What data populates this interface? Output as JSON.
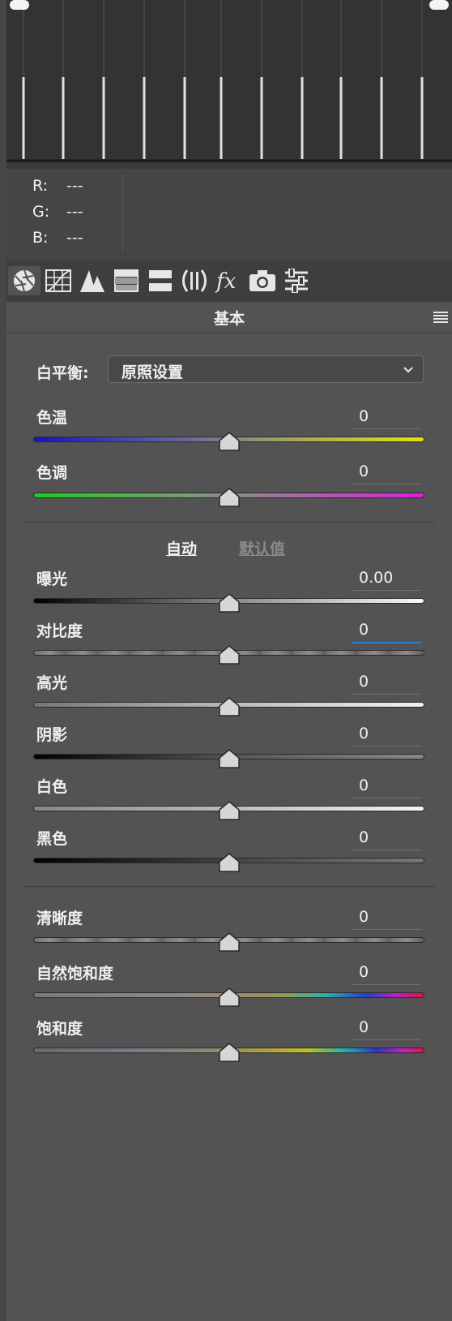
{
  "histogram": {
    "note_columns": 11
  },
  "readout": {
    "r_label": "R:",
    "r_value": "---",
    "g_label": "G:",
    "g_value": "---",
    "b_label": "B:",
    "b_value": "---"
  },
  "tabs": [
    "basic-icon",
    "tone-curve-icon",
    "detail-icon",
    "hsl-icon",
    "split-toning-icon",
    "lens-icon",
    "fx-icon",
    "camera-icon",
    "presets-icon"
  ],
  "panel": {
    "title": "基本"
  },
  "white_balance": {
    "label": "白平衡:",
    "value": "原照设置"
  },
  "sliders": {
    "temp": {
      "label": "色温",
      "value": "0"
    },
    "tint": {
      "label": "色调",
      "value": "0"
    },
    "exposure": {
      "label": "曝光",
      "value": "0.00"
    },
    "contrast": {
      "label": "对比度",
      "value": "0"
    },
    "highlights": {
      "label": "高光",
      "value": "0"
    },
    "shadows": {
      "label": "阴影",
      "value": "0"
    },
    "whites": {
      "label": "白色",
      "value": "0"
    },
    "blacks": {
      "label": "黑色",
      "value": "0"
    },
    "clarity": {
      "label": "清晰度",
      "value": "0"
    },
    "vibrance": {
      "label": "自然饱和度",
      "value": "0"
    },
    "saturation": {
      "label": "饱和度",
      "value": "0"
    }
  },
  "tone": {
    "auto": "自动",
    "default": "默认值"
  },
  "colors": {
    "accent": "#2e7fd8",
    "bg": "#535353"
  }
}
